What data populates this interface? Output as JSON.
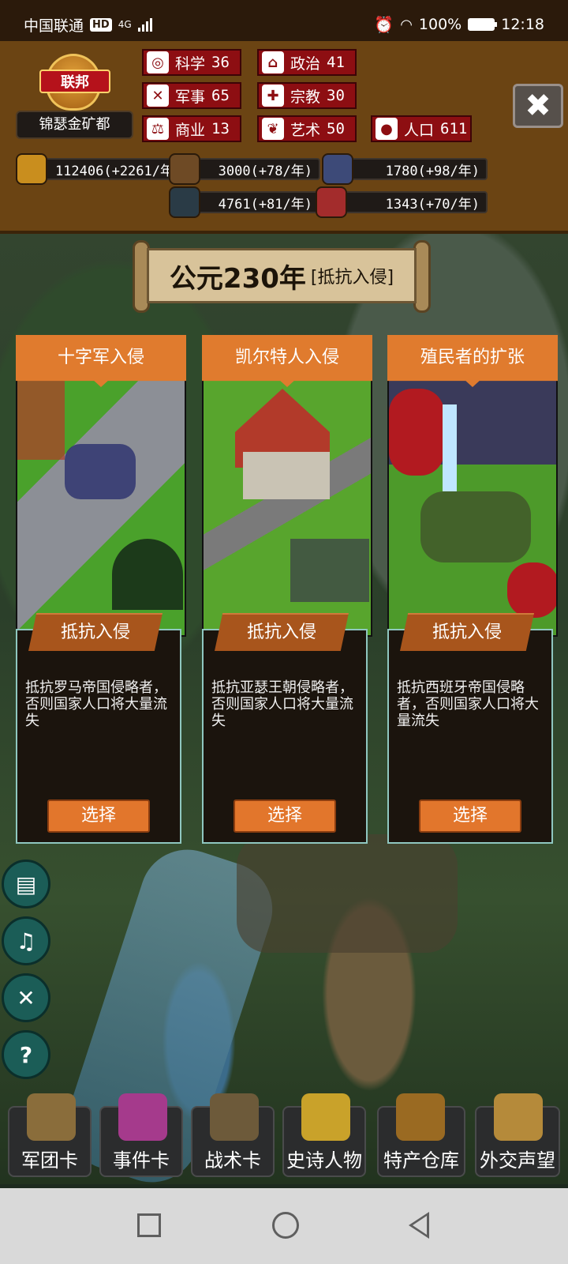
{
  "status": {
    "carrier": "中国联通",
    "hd": "HD",
    "network": "4G",
    "battery": "100%",
    "time": "12:18"
  },
  "emblem": {
    "faction": "联邦",
    "city": "锦瑟金矿都"
  },
  "stats": [
    {
      "label": "科学",
      "value": "36",
      "icon": "planet-icon"
    },
    {
      "label": "政治",
      "value": "41",
      "icon": "government-building-icon"
    },
    {
      "label": "军事",
      "value": "65",
      "icon": "crossed-swords-icon"
    },
    {
      "label": "宗教",
      "value": "30",
      "icon": "cross-icon"
    },
    {
      "label": "商业",
      "value": "13",
      "icon": "scales-icon"
    },
    {
      "label": "艺术",
      "value": "50",
      "icon": "art-icon"
    },
    {
      "label": "人口",
      "value": "611",
      "icon": "person-icon"
    }
  ],
  "resources": [
    {
      "name": "gold",
      "text": "112406(+2261/年",
      "icon": "gold-coins-icon",
      "color": "#c98e1e"
    },
    {
      "name": "wood",
      "text": "3000(+78/年)",
      "icon": "logs-icon",
      "color": "#6e4a25"
    },
    {
      "name": "ore",
      "text": "1780(+98/年)",
      "icon": "ore-icon",
      "color": "#3d4a78"
    },
    {
      "name": "tech",
      "text": "4761(+81/年)",
      "icon": "machine-icon",
      "color": "#2a3b46"
    },
    {
      "name": "meat",
      "text": "1343(+70/年)",
      "icon": "meat-icon",
      "color": "#a32c2c"
    }
  ],
  "banner": {
    "year": "公元230年",
    "subtitle": "[抵抗入侵]"
  },
  "cards": [
    {
      "title": "十字军入侵",
      "ribbon": "抵抗入侵",
      "description": "抵抗罗马帝国侵略者，否则国家人口将大量流失",
      "button": "选择",
      "img_colors": [
        "#4aa12b",
        "#8c8f96",
        "#2b2f6e"
      ]
    },
    {
      "title": "凯尔特人入侵",
      "ribbon": "抵抗入侵",
      "description": "抵抗亚瑟王朝侵略者，否则国家人口将大量流失",
      "button": "选择",
      "img_colors": [
        "#58a52d",
        "#b23a2a",
        "#6a6a6a"
      ]
    },
    {
      "title": "殖民者的扩张",
      "ribbon": "抵抗入侵",
      "description": "抵抗西班牙帝国侵略者，否则国家人口将大量流失",
      "button": "选择",
      "img_colors": [
        "#4d9a2a",
        "#b21a20",
        "#2a3a7a"
      ]
    }
  ],
  "side_buttons": [
    {
      "name": "journal-icon",
      "glyph": "▤"
    },
    {
      "name": "music-note-icon",
      "glyph": "♫"
    },
    {
      "name": "sound-mute-icon",
      "glyph": "✕"
    },
    {
      "name": "help-icon",
      "glyph": "?"
    }
  ],
  "dock": [
    {
      "label": "军团卡",
      "icon": "helmet-icon",
      "color": "#8a6d3b"
    },
    {
      "label": "事件卡",
      "icon": "scroll-icon",
      "color": "#a53a8c"
    },
    {
      "label": "战术卡",
      "icon": "shield-swords-icon",
      "color": "#6d5a3a"
    },
    {
      "label": "史诗人物",
      "icon": "crown-icon",
      "color": "#c9a22a"
    },
    {
      "label": "特产仓库",
      "icon": "treasure-chest-icon",
      "color": "#9a6a22"
    },
    {
      "label": "外交声望",
      "icon": "letter-seal-icon",
      "color": "#b58a3a"
    }
  ],
  "close": "✖"
}
